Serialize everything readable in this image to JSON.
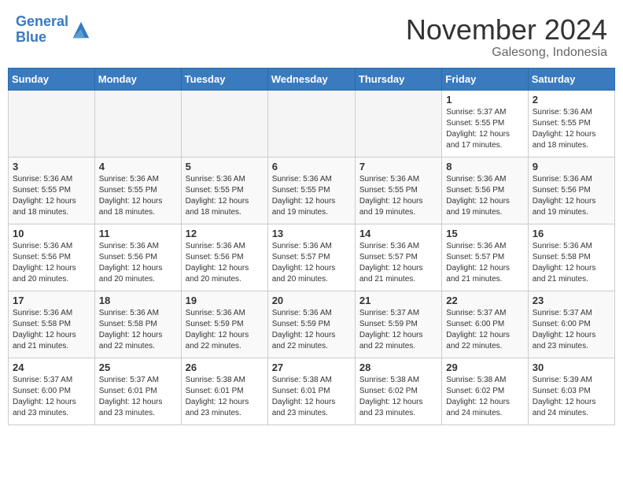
{
  "header": {
    "logo_line1": "General",
    "logo_line2": "Blue",
    "month_title": "November 2024",
    "location": "Galesong, Indonesia"
  },
  "calendar": {
    "weekdays": [
      "Sunday",
      "Monday",
      "Tuesday",
      "Wednesday",
      "Thursday",
      "Friday",
      "Saturday"
    ],
    "weeks": [
      [
        {
          "day": "",
          "info": ""
        },
        {
          "day": "",
          "info": ""
        },
        {
          "day": "",
          "info": ""
        },
        {
          "day": "",
          "info": ""
        },
        {
          "day": "",
          "info": ""
        },
        {
          "day": "1",
          "info": "Sunrise: 5:37 AM\nSunset: 5:55 PM\nDaylight: 12 hours\nand 17 minutes."
        },
        {
          "day": "2",
          "info": "Sunrise: 5:36 AM\nSunset: 5:55 PM\nDaylight: 12 hours\nand 18 minutes."
        }
      ],
      [
        {
          "day": "3",
          "info": "Sunrise: 5:36 AM\nSunset: 5:55 PM\nDaylight: 12 hours\nand 18 minutes."
        },
        {
          "day": "4",
          "info": "Sunrise: 5:36 AM\nSunset: 5:55 PM\nDaylight: 12 hours\nand 18 minutes."
        },
        {
          "day": "5",
          "info": "Sunrise: 5:36 AM\nSunset: 5:55 PM\nDaylight: 12 hours\nand 18 minutes."
        },
        {
          "day": "6",
          "info": "Sunrise: 5:36 AM\nSunset: 5:55 PM\nDaylight: 12 hours\nand 19 minutes."
        },
        {
          "day": "7",
          "info": "Sunrise: 5:36 AM\nSunset: 5:55 PM\nDaylight: 12 hours\nand 19 minutes."
        },
        {
          "day": "8",
          "info": "Sunrise: 5:36 AM\nSunset: 5:56 PM\nDaylight: 12 hours\nand 19 minutes."
        },
        {
          "day": "9",
          "info": "Sunrise: 5:36 AM\nSunset: 5:56 PM\nDaylight: 12 hours\nand 19 minutes."
        }
      ],
      [
        {
          "day": "10",
          "info": "Sunrise: 5:36 AM\nSunset: 5:56 PM\nDaylight: 12 hours\nand 20 minutes."
        },
        {
          "day": "11",
          "info": "Sunrise: 5:36 AM\nSunset: 5:56 PM\nDaylight: 12 hours\nand 20 minutes."
        },
        {
          "day": "12",
          "info": "Sunrise: 5:36 AM\nSunset: 5:56 PM\nDaylight: 12 hours\nand 20 minutes."
        },
        {
          "day": "13",
          "info": "Sunrise: 5:36 AM\nSunset: 5:57 PM\nDaylight: 12 hours\nand 20 minutes."
        },
        {
          "day": "14",
          "info": "Sunrise: 5:36 AM\nSunset: 5:57 PM\nDaylight: 12 hours\nand 21 minutes."
        },
        {
          "day": "15",
          "info": "Sunrise: 5:36 AM\nSunset: 5:57 PM\nDaylight: 12 hours\nand 21 minutes."
        },
        {
          "day": "16",
          "info": "Sunrise: 5:36 AM\nSunset: 5:58 PM\nDaylight: 12 hours\nand 21 minutes."
        }
      ],
      [
        {
          "day": "17",
          "info": "Sunrise: 5:36 AM\nSunset: 5:58 PM\nDaylight: 12 hours\nand 21 minutes."
        },
        {
          "day": "18",
          "info": "Sunrise: 5:36 AM\nSunset: 5:58 PM\nDaylight: 12 hours\nand 22 minutes."
        },
        {
          "day": "19",
          "info": "Sunrise: 5:36 AM\nSunset: 5:59 PM\nDaylight: 12 hours\nand 22 minutes."
        },
        {
          "day": "20",
          "info": "Sunrise: 5:36 AM\nSunset: 5:59 PM\nDaylight: 12 hours\nand 22 minutes."
        },
        {
          "day": "21",
          "info": "Sunrise: 5:37 AM\nSunset: 5:59 PM\nDaylight: 12 hours\nand 22 minutes."
        },
        {
          "day": "22",
          "info": "Sunrise: 5:37 AM\nSunset: 6:00 PM\nDaylight: 12 hours\nand 22 minutes."
        },
        {
          "day": "23",
          "info": "Sunrise: 5:37 AM\nSunset: 6:00 PM\nDaylight: 12 hours\nand 23 minutes."
        }
      ],
      [
        {
          "day": "24",
          "info": "Sunrise: 5:37 AM\nSunset: 6:00 PM\nDaylight: 12 hours\nand 23 minutes."
        },
        {
          "day": "25",
          "info": "Sunrise: 5:37 AM\nSunset: 6:01 PM\nDaylight: 12 hours\nand 23 minutes."
        },
        {
          "day": "26",
          "info": "Sunrise: 5:38 AM\nSunset: 6:01 PM\nDaylight: 12 hours\nand 23 minutes."
        },
        {
          "day": "27",
          "info": "Sunrise: 5:38 AM\nSunset: 6:01 PM\nDaylight: 12 hours\nand 23 minutes."
        },
        {
          "day": "28",
          "info": "Sunrise: 5:38 AM\nSunset: 6:02 PM\nDaylight: 12 hours\nand 23 minutes."
        },
        {
          "day": "29",
          "info": "Sunrise: 5:38 AM\nSunset: 6:02 PM\nDaylight: 12 hours\nand 24 minutes."
        },
        {
          "day": "30",
          "info": "Sunrise: 5:39 AM\nSunset: 6:03 PM\nDaylight: 12 hours\nand 24 minutes."
        }
      ]
    ]
  }
}
